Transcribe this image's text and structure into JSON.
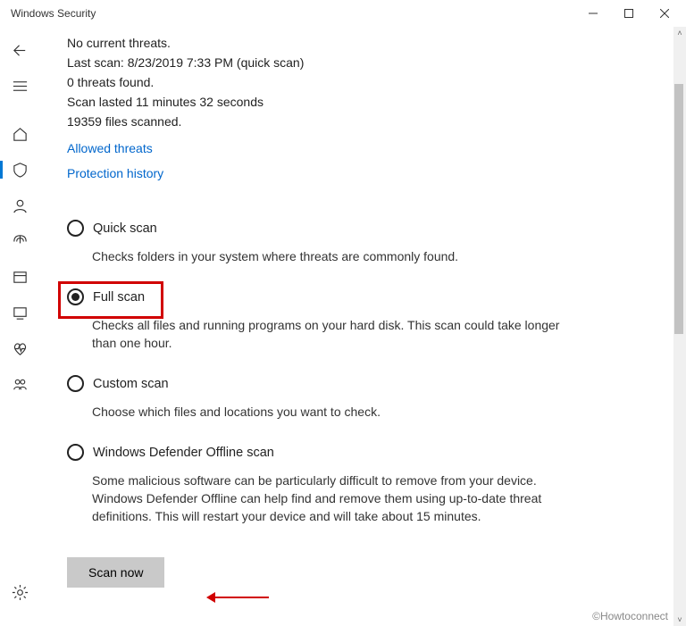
{
  "window": {
    "title": "Windows Security"
  },
  "status": {
    "line1": "No current threats.",
    "line2": "Last scan: 8/23/2019 7:33 PM (quick scan)",
    "line3": "0 threats found.",
    "line4": "Scan lasted 11 minutes 32 seconds",
    "line5": "19359 files scanned."
  },
  "links": {
    "allowed": "Allowed threats",
    "history": "Protection history"
  },
  "options": {
    "quick": {
      "title": "Quick scan",
      "desc": "Checks folders in your system where threats are commonly found."
    },
    "full": {
      "title": "Full scan",
      "desc": "Checks all files and running programs on your hard disk. This scan could take longer than one hour."
    },
    "custom": {
      "title": "Custom scan",
      "desc": "Choose which files and locations you want to check."
    },
    "offline": {
      "title": "Windows Defender Offline scan",
      "desc": "Some malicious software can be particularly difficult to remove from your device. Windows Defender Offline can help find and remove them using up-to-date threat definitions. This will restart your device and will take about 15 minutes."
    }
  },
  "actions": {
    "scan_now": "Scan now"
  },
  "watermark": "©Howtoconnect"
}
